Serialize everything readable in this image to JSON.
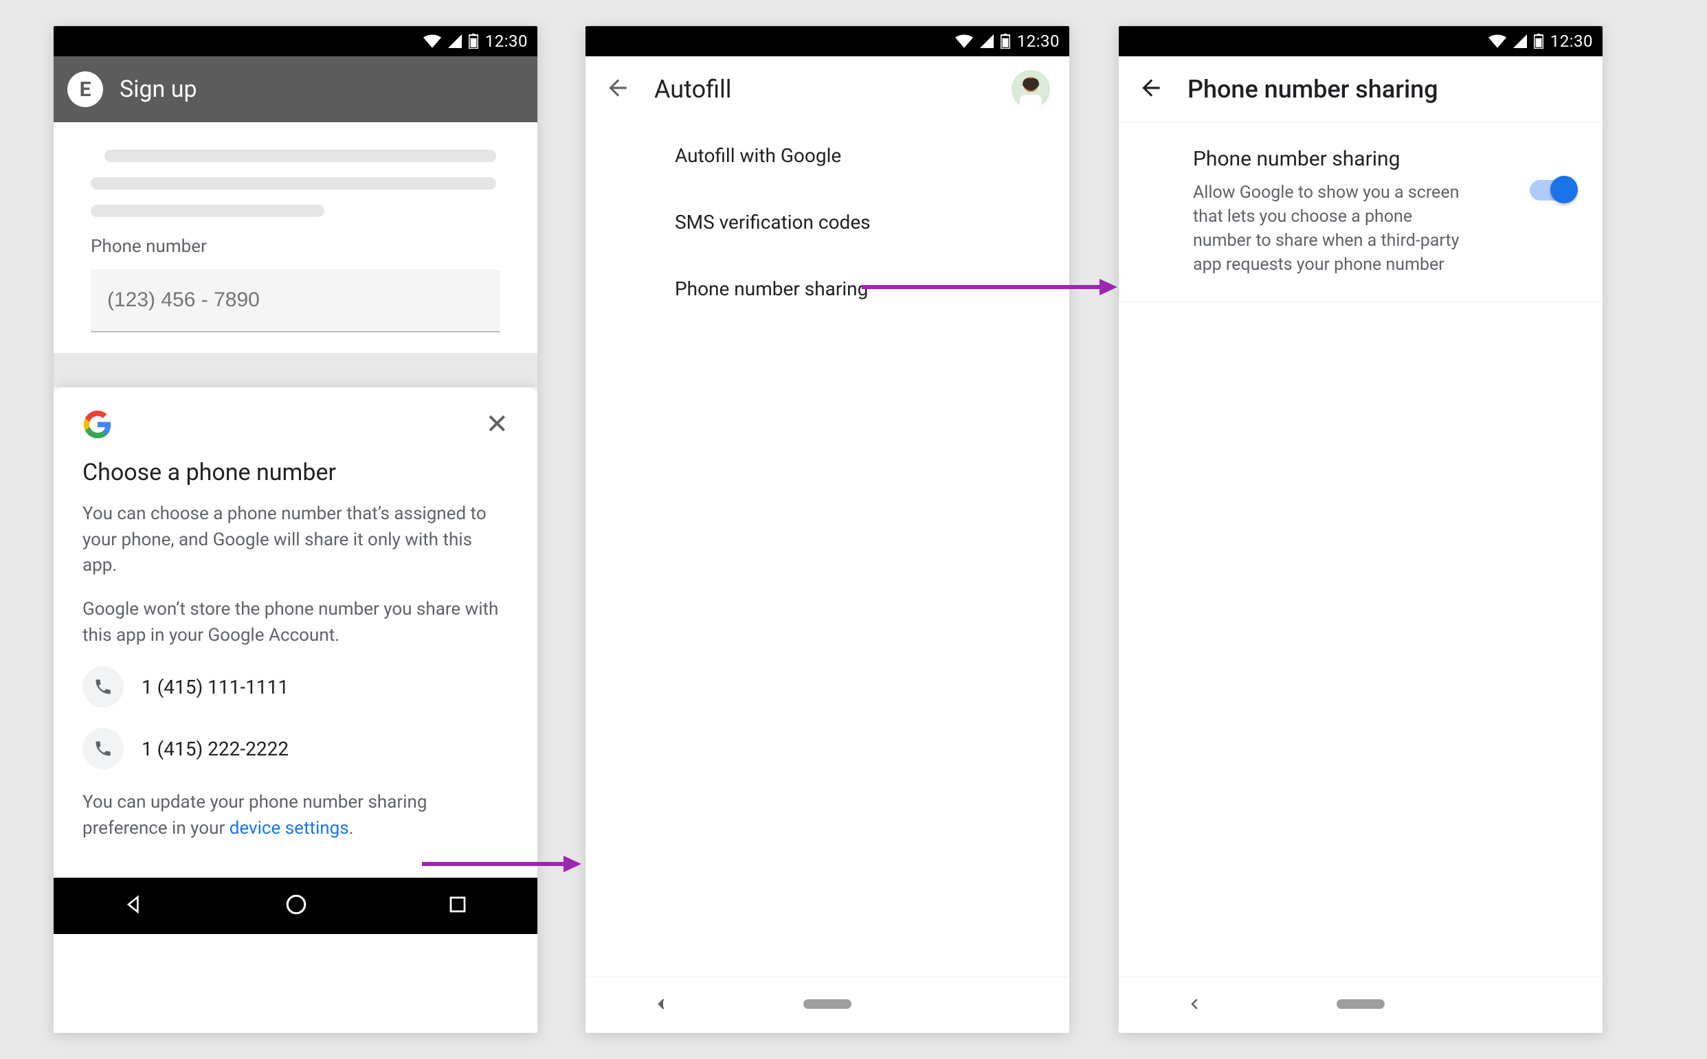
{
  "status": {
    "time": "12:30"
  },
  "phone1": {
    "app_letter": "E",
    "title": "Sign up",
    "field_label": "Phone number",
    "placeholder": "(123) 456 - 7890",
    "sheet": {
      "title": "Choose a phone number",
      "body1": "You can choose a phone number that’s assigned to your phone, and Google will share it only with this app.",
      "body2": "Google won’t store the phone number you share with this app in your Google Account.",
      "numbers": [
        "1 (415) 111-1111",
        "1 (415) 222-2222"
      ],
      "footer_prefix": "You can update your phone number sharing preference in your ",
      "footer_link": "device settings",
      "footer_suffix": "."
    }
  },
  "phone2": {
    "title": "Autofill",
    "items": [
      "Autofill with Google",
      "SMS verification codes",
      "Phone number sharing"
    ]
  },
  "phone3": {
    "title": "Phone number sharing",
    "setting_title": "Phone number sharing",
    "setting_desc": "Allow Google to show you a screen that lets you choose a phone number to share when a third-party app requests your phone number"
  }
}
